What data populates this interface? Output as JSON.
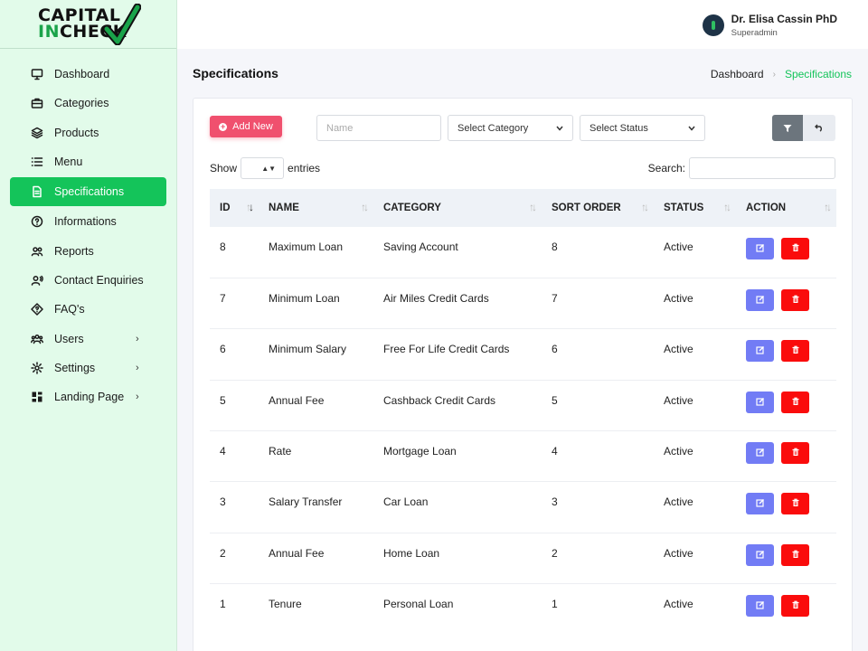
{
  "brand": {
    "line1": "CAPITAL",
    "line2_in": "IN",
    "line2_rest": "CHECK",
    "accent": "#14c45a"
  },
  "user": {
    "name": "Dr. Elisa Cassin PhD",
    "role": "Superadmin"
  },
  "sidebar": {
    "items": [
      {
        "label": "Dashboard",
        "icon": "monitor-icon"
      },
      {
        "label": "Categories",
        "icon": "briefcase-icon"
      },
      {
        "label": "Products",
        "icon": "layers-icon"
      },
      {
        "label": "Menu",
        "icon": "list-icon"
      },
      {
        "label": "Specifications",
        "icon": "document-icon",
        "active": true
      },
      {
        "label": "Informations",
        "icon": "help-circle-icon"
      },
      {
        "label": "Reports",
        "icon": "users-icon"
      },
      {
        "label": "Contact Enquiries",
        "icon": "user-voice-icon"
      },
      {
        "label": "FAQ's",
        "icon": "diamond-question-icon"
      },
      {
        "label": "Users",
        "icon": "group-icon",
        "chevron": true
      },
      {
        "label": "Settings",
        "icon": "gear-icon",
        "chevron": true
      },
      {
        "label": "Landing Page",
        "icon": "grid-icon",
        "chevron": true
      }
    ]
  },
  "page": {
    "title": "Specifications"
  },
  "breadcrumb": {
    "home": "Dashboard",
    "current": "Specifications"
  },
  "toolbar": {
    "add_label": "Add New",
    "name_placeholder": "Name",
    "category_value": "Select Category",
    "status_value": "Select Status"
  },
  "table_controls": {
    "show_label": "Show",
    "entries_label": "entries",
    "search_label": "Search:"
  },
  "table": {
    "columns": [
      "ID",
      "NAME",
      "CATEGORY",
      "SORT ORDER",
      "STATUS",
      "ACTION"
    ],
    "rows": [
      {
        "id": "8",
        "name": "Maximum Loan",
        "category": "Saving Account",
        "sort": "8",
        "status": "Active"
      },
      {
        "id": "7",
        "name": "Minimum Loan",
        "category": "Air Miles Credit Cards",
        "sort": "7",
        "status": "Active"
      },
      {
        "id": "6",
        "name": "Minimum Salary",
        "category": "Free For Life Credit Cards",
        "sort": "6",
        "status": "Active"
      },
      {
        "id": "5",
        "name": "Annual Fee",
        "category": "Cashback Credit Cards",
        "sort": "5",
        "status": "Active"
      },
      {
        "id": "4",
        "name": "Rate",
        "category": "Mortgage Loan",
        "sort": "4",
        "status": "Active"
      },
      {
        "id": "3",
        "name": "Salary Transfer",
        "category": "Car Loan",
        "sort": "3",
        "status": "Active"
      },
      {
        "id": "2",
        "name": "Annual Fee",
        "category": "Home Loan",
        "sort": "2",
        "status": "Active"
      },
      {
        "id": "1",
        "name": "Tenure",
        "category": "Personal Loan",
        "sort": "1",
        "status": "Active"
      }
    ]
  },
  "colors": {
    "edit": "#727cf5",
    "delete": "#fa0c0c",
    "add": "#f0506e",
    "sidebar_bg": "#e2fbea"
  }
}
